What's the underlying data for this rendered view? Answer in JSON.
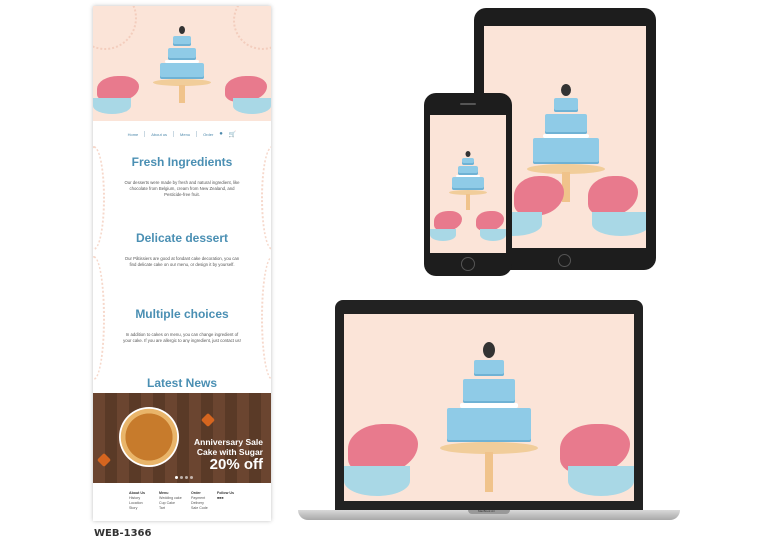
{
  "nav": {
    "items": [
      "Home",
      "About us",
      "Menu",
      "Order"
    ],
    "icons": [
      "user-icon",
      "cart-icon"
    ],
    "accent": "#4c88ab"
  },
  "sections": [
    {
      "title": "Fresh Ingredients",
      "text": "Our desserts were made by fresh and natural ingredient, like chocolate from Belgium, cream from New Zealand, and Pesticide-free fruit."
    },
    {
      "title": "Delicate dessert",
      "text": "Our Pâtissiers are good at fondant cake decoration, you can find delicate cake on our menu, or design it by yourself."
    },
    {
      "title": "Multiple choices",
      "text": "In addition to cakes on menu, you can change ingredient of your cake. If you are allergic to any ingredient, just contact us!"
    }
  ],
  "news": {
    "title": "Latest News",
    "banner": {
      "line1": "Anniversary Sale",
      "line2": "Cake with Sugar",
      "line3": "20% off"
    }
  },
  "footer": {
    "columns": [
      {
        "heading": "About Us",
        "links": [
          "History",
          "Location",
          "Story"
        ]
      },
      {
        "heading": "Menu",
        "links": [
          "Wedding cake",
          "Cup Cake",
          "Tart"
        ]
      },
      {
        "heading": "Order",
        "links": [
          "Payment",
          "Delivery",
          "Sale Code"
        ]
      },
      {
        "heading": "Follow Us",
        "links": []
      }
    ]
  },
  "label": "WEB-1366",
  "laptop_brand": "MacBook Air",
  "colors": {
    "title_blue": "#4a8fb3",
    "hero_bg": "#fbe4d8",
    "cake_blue": "#8fcbe7",
    "splash_pink": "#e87a8d"
  }
}
